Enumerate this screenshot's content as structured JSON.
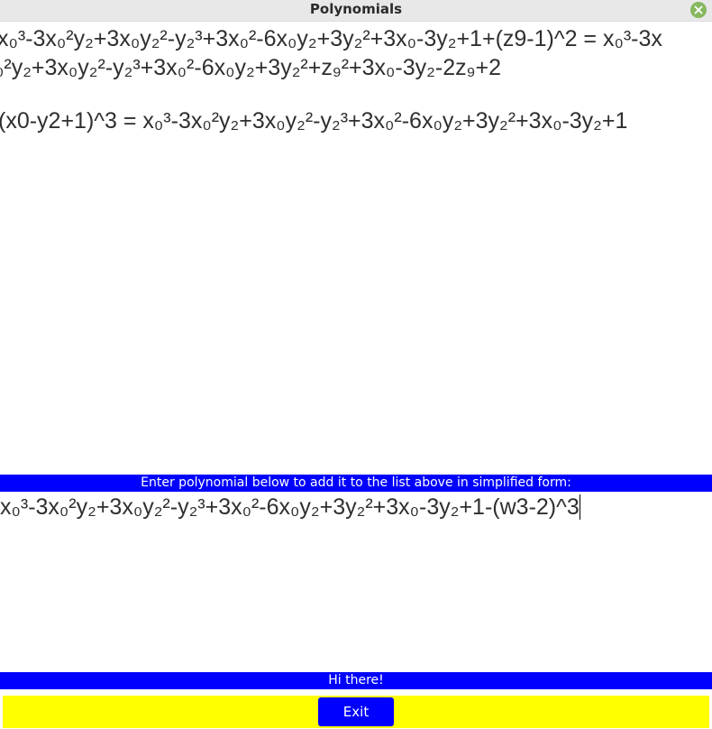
{
  "window": {
    "title": "Polynomials",
    "close_icon": "close-x-icon"
  },
  "output": {
    "lines": [
      "x₀³-3x₀²y₂+3x₀y₂²-y₂³+3x₀²-6x₀y₂+3y₂²+3x₀-3y₂+1+(z9-1)^2 = x₀³-3x",
      "₀²y₂+3x₀y₂²-y₂³+3x₀²-6x₀y₂+3y₂²+z₉²+3x₀-3y₂-2z₉+2",
      "(x0-y2+1)^3 = x₀³-3x₀²y₂+3x₀y₂²-y₂³+3x₀²-6x₀y₂+3y₂²+3x₀-3y₂+1"
    ]
  },
  "prompt": {
    "label": "Enter polynomial below to add it to the list above in simplified form:"
  },
  "input": {
    "value": "x₀³-3x₀²y₂+3x₀y₂²-y₂³+3x₀²-6x₀y₂+3y₂²+3x₀-3y₂+1-(w3-2)^3"
  },
  "status": {
    "message": "Hi there!"
  },
  "buttons": {
    "exit_label": "Exit"
  },
  "colors": {
    "accent_blue": "#0000ff",
    "button_bar_yellow": "#ffff00",
    "close_green": "#87b85f"
  }
}
